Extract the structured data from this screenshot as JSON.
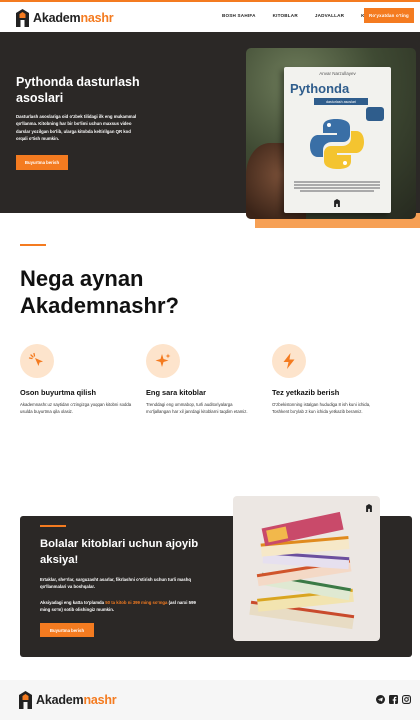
{
  "brand": {
    "name_part1": "Akadem",
    "name_part2": "nashr",
    "accent_color": "#f47b20",
    "dark_color": "#2b2826"
  },
  "nav": {
    "items": [
      "Bosh sahifa",
      "Kitoblar",
      "Jadvallar",
      "Kontaktlar"
    ],
    "cta_label": "Ro'yxatdan o'ting"
  },
  "hero": {
    "title": "Pythonda dasturlash asoslari",
    "description": "Dasturlash asoslariga oid o'zbek tilidagi ilk eng mukammal qo'llanma. Kitobning har bir bo'limi uchun maxsus video darslar yozilgan bo'lib, ularga kitobda keltirilgan QR kod orqali o'tish mumkin.",
    "button_label": "Buyurtma berish",
    "book": {
      "author": "Anvar Narzullayev",
      "title": "Pythonda",
      "subtitle": "dasturlash asoslari"
    }
  },
  "why": {
    "title": "Nega aynan Akademnashr?",
    "features": [
      {
        "icon": "cursor-click-icon",
        "title": "Oson buyurtma qilish",
        "description": "Akademnashr.uz saytidan o'zingizga yoqqan kitobni sodda usulda buyurtma qila olasiz."
      },
      {
        "icon": "sparkle-icon",
        "title": "Eng sara kitoblar",
        "description": "Trenddagi eng ommabop, turli auditoriyalarga mo'ljallangan har xil janrdagi kitoblarni taqdim etamiz."
      },
      {
        "icon": "lightning-icon",
        "title": "Tez yetkazib berish",
        "description": "O'zbekistonning istalgan hududiga 8 ish kuni ichida, Toshkent bo'ylab 2 kun ichida yetkazib beramiz."
      }
    ]
  },
  "promo": {
    "title": "Bolalar kitoblari uchun ajoyib aksiya!",
    "description": "Ertaklar, she'rlar, sarguzasht asarlar, fikrlashni o'stirish uchun turli mashq qo'llanmalari va boshqalar.",
    "note_before": "Aksiyadagi eng katta to'plamda ",
    "note_highlight": "50 ta kitob ni 399 ming so'mga",
    "note_after": " (asl narxi 599 ming so'm) sotib olishingiz mumkin.",
    "button_label": "Buyurtma berish"
  },
  "footer": {
    "social": [
      "telegram-icon",
      "facebook-icon",
      "instagram-icon"
    ]
  }
}
